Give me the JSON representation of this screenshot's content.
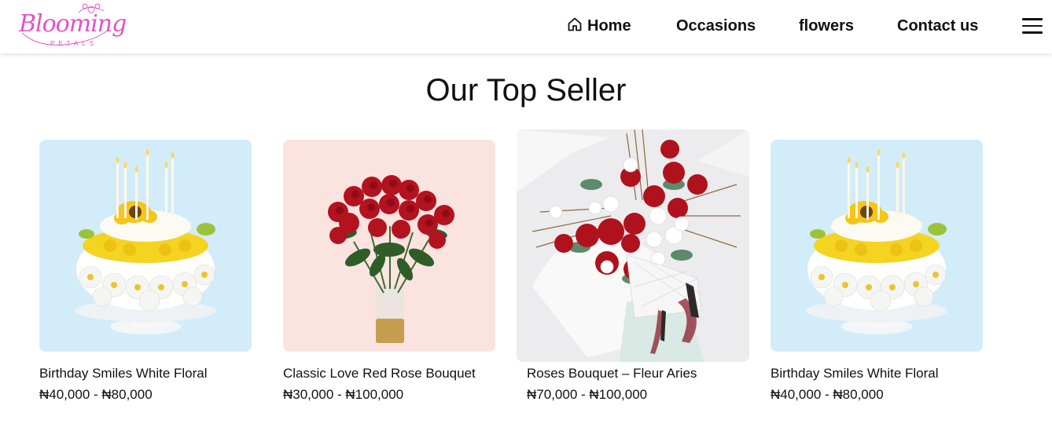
{
  "brand": {
    "logo_script": "Blooming",
    "logo_sub": "PETALS"
  },
  "nav": {
    "home": "Home",
    "occasions": "Occasions",
    "flowers": "flowers",
    "contact": "Contact us"
  },
  "section": {
    "title": "Our Top Seller"
  },
  "products": [
    {
      "name": "Birthday Smiles White Floral",
      "price": "₦40,000 - ₦80,000",
      "image": "daisy-cake-arrangement"
    },
    {
      "name": "Classic Love Red Rose Bouquet",
      "price": "₦30,000 - ₦100,000",
      "image": "red-rose-vase"
    },
    {
      "name": "Roses Bouquet – Fleur Aries",
      "price": "₦70,000 - ₦100,000",
      "image": "wrapped-rose-bouquet"
    },
    {
      "name": "Birthday Smiles White Floral",
      "price": "₦40,000 - ₦80,000",
      "image": "daisy-cake-arrangement"
    }
  ],
  "colors": {
    "brand_pink": "#e451c8",
    "light_blue_bg": "#d3ecfa",
    "pink_bg": "#fbe3e0",
    "rose_red": "#b3121f"
  },
  "icons": {
    "home": "home-icon",
    "menu": "hamburger-menu-icon"
  }
}
